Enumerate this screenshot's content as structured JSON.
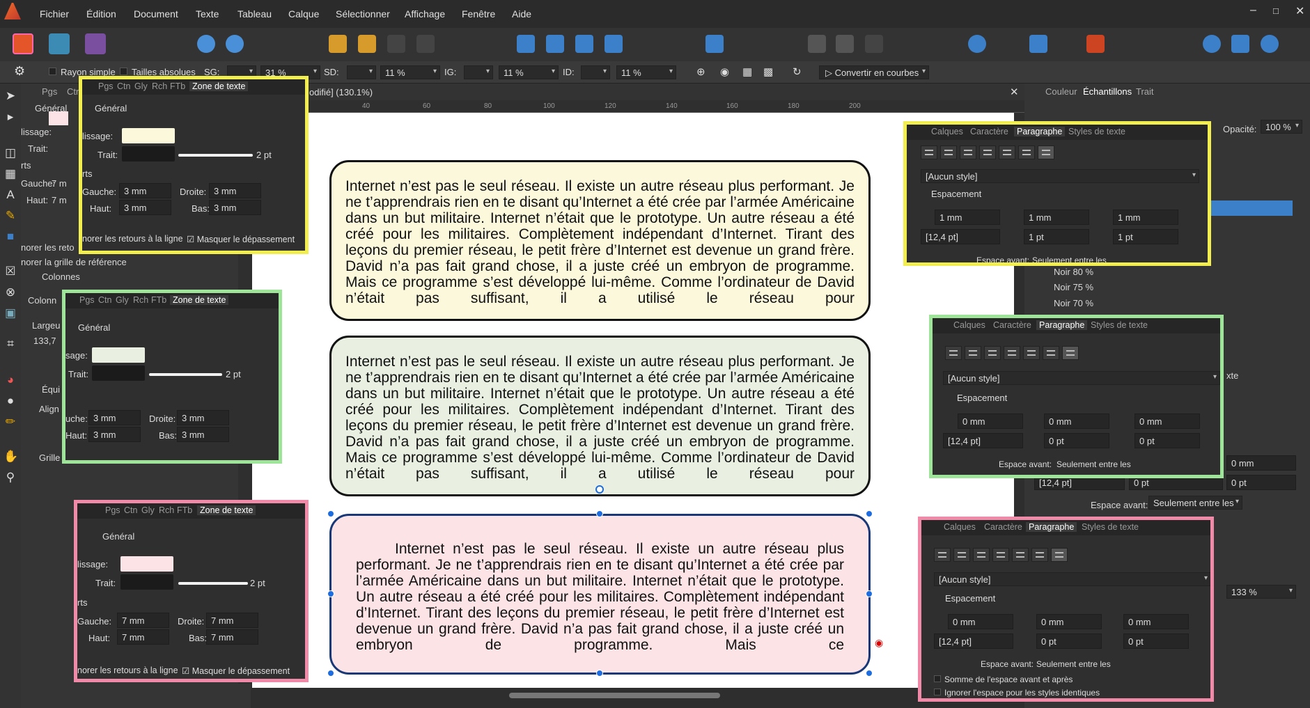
{
  "menu": [
    "Fichier",
    "Édition",
    "Document",
    "Texte",
    "Tableau",
    "Calque",
    "Sélectionner",
    "Affichage",
    "Fenêtre",
    "Aide"
  ],
  "context_bar": {
    "rayon_simple": "Rayon simple",
    "tailles_absolues": "Tailles absolues",
    "sg": "SG:",
    "sg_val": "31 %",
    "sd": "SD:",
    "sd_val": "11 %",
    "ig": "IG:",
    "ig_val": "11 %",
    "id": "ID:",
    "id_val": "11 %",
    "convertir": "Convertir en courbes"
  },
  "doc_tab": "odifié] (130.1%)",
  "ruler": [
    "40",
    "60",
    "80",
    "100",
    "120",
    "140",
    "160",
    "180",
    "200"
  ],
  "left_panel": {
    "tabs": [
      "Pgs",
      "Ctr"
    ],
    "general": "Général",
    "lissage": "lissage:",
    "trait": "Trait:",
    "rts": "rts",
    "gauche": "Gauche:",
    "gauche_val": "7 m",
    "haut": "Haut:",
    "haut_val": "7 m",
    "ignorer": "norer les reto",
    "ignorer_grille": "norer la grille de référence",
    "colonnes": "Colonnes",
    "colonne": "Colonn",
    "largeur": "Largeu",
    "largeur_val": "133,7",
    "equi": "Équi",
    "align": "Align",
    "grille": "Grille"
  },
  "frame_texts": [
    "Internet n’est pas le seul réseau. Il existe un autre réseau plus performant. Je ne t’apprendrais rien en te disant qu’Internet a été crée par l’armée Américaine dans un but militaire. Internet n’était que le prototype. Un autre réseau a été créé pour les militaires. Complètement indépendant d’Internet. Tirant des leçons du premier réseau, le petit frère d’Internet est devenue un grand frère. David n’a pas fait grand chose, il a juste créé un embryon de programme. Mais ce programme s’est développé lui-même. Comme l’ordinateur de David n’était pas suffisant, il a utilisé le réseau pour",
    "Internet n’est pas le seul réseau. Il existe un autre réseau plus performant. Je ne t’apprendrais rien en te disant qu’Internet a été crée par l’armée Américaine dans un but militaire. Internet n’était que le prototype. Un autre réseau a été créé pour les militaires. Complètement indépendant d’Internet. Tirant des leçons du premier réseau, le petit frère d’Internet est devenue un grand frère. David n’a pas fait grand chose, il a juste créé un embryon de programme. Mais ce programme s’est développé lui-même. Comme l’ordinateur de David n’était pas suffisant, il a utilisé le réseau pour",
    "Internet n’est pas le seul réseau. Il existe un autre réseau plus performant. Je ne t’apprendrais rien en te disant qu’Internet a été crée par l’armée Américaine dans un but militaire. Internet n’était que le prototype. Un autre réseau a été créé pour les militaires. Complètement indépendant d’Internet. Tirant des leçons du premier réseau, le petit frère d’Internet est devenue un grand frère. David n’a pas fait grand chose, il a juste créé un embryon de programme. Mais ce"
  ],
  "frame_colors": [
    "#fbf8dc",
    "#e9f0e2",
    "#fbe3e6"
  ],
  "callouts_left": [
    {
      "color": "#f3ee4f",
      "tabs": [
        "Pgs",
        "Ctn",
        "Gly",
        "Rch",
        "FTb",
        "Zone de texte"
      ],
      "general": "Général",
      "lissage": "lissage:",
      "trait": "Trait:",
      "trait_val": "2 pt",
      "rts": "rts",
      "gauche": "Gauche:",
      "gauche_val": "3 mm",
      "droite": "Droite:",
      "droite_val": "3 mm",
      "haut": "Haut:",
      "haut_val": "3 mm",
      "bas": "Bas:",
      "bas_val": "3 mm",
      "ignorer": "norer les retours à la ligne",
      "masquer": "Masquer le dépassement",
      "fill": "#fbf8dc"
    },
    {
      "color": "#9ee59a",
      "tabs": [
        "Pgs",
        "Ctn",
        "Gly",
        "Rch",
        "FTb",
        "Zone de texte"
      ],
      "general": "Général",
      "lissage": "sage:",
      "trait": "Trait:",
      "trait_val": "2 pt",
      "gauche": "uche:",
      "gauche_val": "3 mm",
      "droite": "Droite:",
      "droite_val": "3 mm",
      "haut": "Haut:",
      "haut_val": "3 mm",
      "bas": "Bas:",
      "bas_val": "3 mm",
      "fill": "#e9f0e2"
    },
    {
      "color": "#f08aa8",
      "tabs": [
        "Pgs",
        "Ctn",
        "Gly",
        "Rch",
        "FTb",
        "Zone de texte"
      ],
      "general": "Général",
      "lissage": "lissage:",
      "trait": "Trait:",
      "trait_val": "2 pt",
      "rts": "rts",
      "gauche": "Gauche:",
      "gauche_val": "7 mm",
      "droite": "Droite:",
      "droite_val": "7 mm",
      "haut": "Haut:",
      "haut_val": "7 mm",
      "bas": "Bas:",
      "bas_val": "7 mm",
      "ignorer": "norer les retours à la ligne",
      "masquer": "Masquer le dépassement",
      "fill": "#fbe3e6"
    }
  ],
  "callouts_right": [
    {
      "color": "#f3ee4f",
      "tabs": [
        "Calques",
        "Caractère",
        "Paragraphe",
        "Styles de texte"
      ],
      "style": "[Aucun style]",
      "espacement": "Espacement",
      "v1": "1 mm",
      "v2": "1 mm",
      "v3": "1 mm",
      "v4": "[12,4 pt]",
      "v5": "1 pt",
      "v6": "1 pt",
      "espace_avant": "Espace avant:",
      "espace_avant_val": "Seulement entre les"
    },
    {
      "color": "#9ee59a",
      "tabs": [
        "Calques",
        "Caractère",
        "Paragraphe",
        "Styles de texte"
      ],
      "style": "[Aucun style]",
      "espacement": "Espacement",
      "v1": "0 mm",
      "v2": "0 mm",
      "v3": "0 mm",
      "v4": "[12,4 pt]",
      "v5": "0 pt",
      "v6": "0 pt",
      "espace_avant": "Espace avant:",
      "espace_avant_val": "Seulement entre les"
    },
    {
      "color": "#f08aa8",
      "tabs": [
        "Calques",
        "Caractère",
        "Paragraphe",
        "Styles de texte"
      ],
      "style": "[Aucun style]",
      "espacement": "Espacement",
      "v1": "0 mm",
      "v2": "0 mm",
      "v3": "0 mm",
      "v4": "[12,4 pt]",
      "v5": "0 pt",
      "v6": "0 pt",
      "espace_avant": "Espace avant:",
      "espace_avant_val": "Seulement entre les",
      "somme": "Somme de l'espace avant et après",
      "ignorer": "Ignorer l'espace pour les styles identiques"
    }
  ],
  "right_panel": {
    "tabs": [
      "Couleur",
      "Échantillons",
      "Trait"
    ],
    "opacite": "Opacité:",
    "opacite_val": "100 %",
    "noirs": [
      "Noir 80 %",
      "Noir 75 %",
      "Noir 70 %"
    ],
    "xte": "xte",
    "mm": "0 mm",
    "pt": "0 pt",
    "pt12": "[12,4 pt]",
    "espace_avant": "Espace avant:",
    "espace_val": "Seulement entre les",
    "zoom": "133 %"
  }
}
